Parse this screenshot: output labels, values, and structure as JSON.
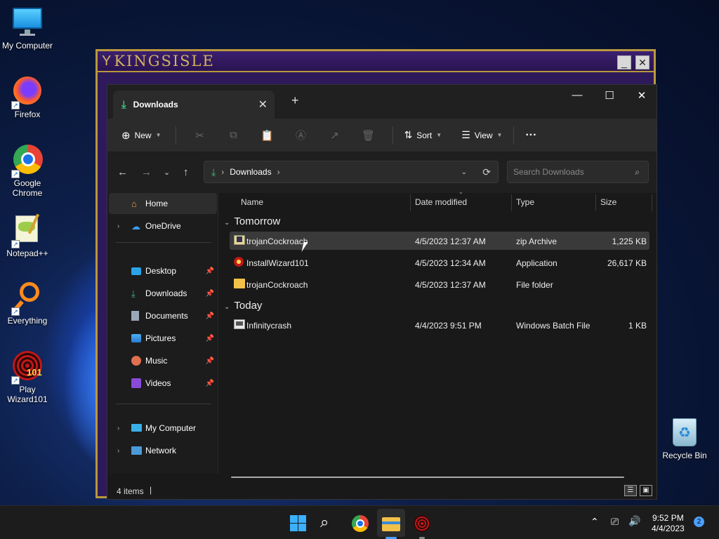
{
  "desktop": {
    "icons": [
      {
        "label": "My Computer"
      },
      {
        "label": "Firefox"
      },
      {
        "label": "Google Chrome"
      },
      {
        "label": "Notepad++"
      },
      {
        "label": "Everything"
      },
      {
        "label": "Play Wizard101"
      }
    ],
    "recycle_bin": "Recycle Bin"
  },
  "kingsisle": {
    "logo": "KINGSISLE",
    "minimize": "_",
    "close": "✕"
  },
  "explorer": {
    "tab_title": "Downloads",
    "tab_close": "✕",
    "new_tab": "+",
    "toolbar": {
      "new_label": "New",
      "sort_label": "Sort",
      "view_label": "View",
      "more": "···"
    },
    "address": {
      "path": "Downloads",
      "search_placeholder": "Search Downloads"
    },
    "sidebar": {
      "home": "Home",
      "onedrive": "OneDrive",
      "desktop": "Desktop",
      "downloads": "Downloads",
      "documents": "Documents",
      "pictures": "Pictures",
      "music": "Music",
      "videos": "Videos",
      "my_computer": "My Computer",
      "network": "Network"
    },
    "columns": {
      "name": "Name",
      "date": "Date modified",
      "type": "Type",
      "size": "Size"
    },
    "groups": {
      "tomorrow": "Tomorrow",
      "today": "Today"
    },
    "files": [
      {
        "name": "trojanCockroach",
        "date": "4/5/2023 12:37 AM",
        "type": "zip Archive",
        "size": "1,225 KB"
      },
      {
        "name": "InstallWizard101",
        "date": "4/5/2023 12:34 AM",
        "type": "Application",
        "size": "26,617 KB"
      },
      {
        "name": "trojanCockroach",
        "date": "4/5/2023 12:37 AM",
        "type": "File folder",
        "size": ""
      },
      {
        "name": "Infinitycrash",
        "date": "4/4/2023 9:51 PM",
        "type": "Windows Batch File",
        "size": "1 KB"
      }
    ],
    "status": "4 items"
  },
  "taskbar": {
    "time": "9:52 PM",
    "date": "4/4/2023",
    "notifications": "2"
  }
}
